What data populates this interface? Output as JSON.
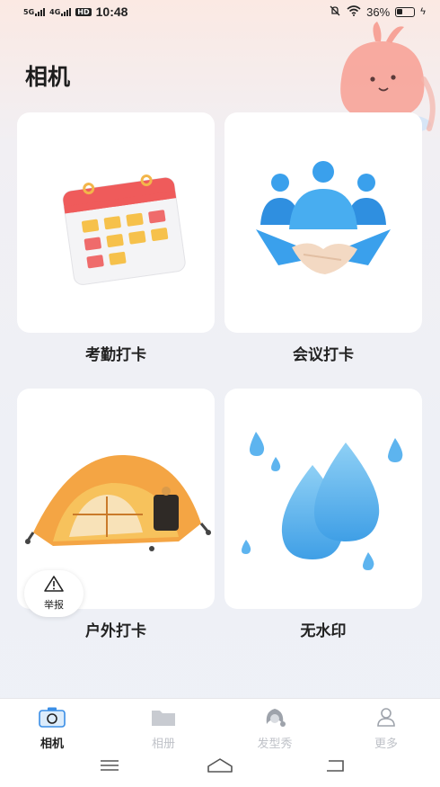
{
  "status_bar": {
    "sim1": "5G",
    "sim2": "4G",
    "hd": "HD",
    "time": "10:48",
    "battery_percent": "36%"
  },
  "header": {
    "title": "相机"
  },
  "cards": [
    {
      "label": "考勤打卡",
      "icon": "calendar-icon"
    },
    {
      "label": "会议打卡",
      "icon": "handshake-meeting-icon"
    },
    {
      "label": "户外打卡",
      "icon": "tent-icon"
    },
    {
      "label": "无水印",
      "icon": "water-drop-icon"
    }
  ],
  "report": {
    "label": "举报",
    "icon": "warning-icon"
  },
  "tabbar": {
    "tabs": [
      {
        "label": "相机",
        "icon": "camera-icon",
        "active": true
      },
      {
        "label": "相册",
        "icon": "folder-icon",
        "active": false
      },
      {
        "label": "发型秀",
        "icon": "hairstyle-icon",
        "active": false
      },
      {
        "label": "更多",
        "icon": "person-icon",
        "active": false
      }
    ]
  },
  "colors": {
    "accent_blue": "#3a8ee6",
    "calendar_red": "#ef5b5b",
    "calendar_yellow": "#f6c14b",
    "tent_orange": "#f4a544",
    "drop_blue": "#59b7ef",
    "inactive_tab": "#bfc2c8"
  }
}
